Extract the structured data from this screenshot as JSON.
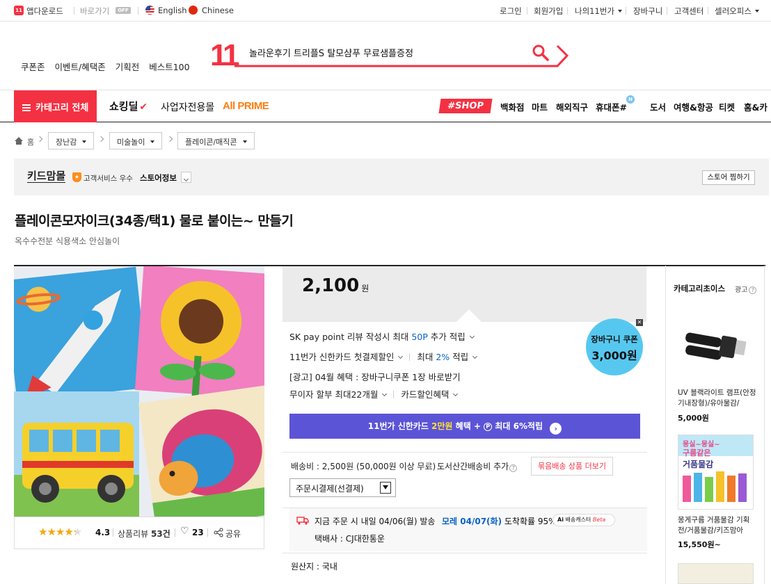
{
  "topbar": {
    "app_download": "앱다운로드",
    "shortcut": "바로가기",
    "shortcut_state": "OFF",
    "lang_en": "English",
    "lang_cn": "Chinese",
    "links": [
      "로그인",
      "회원가입",
      "나의11번가",
      "장바구니",
      "고객센터",
      "셀러오피스"
    ]
  },
  "header": {
    "logo": "11",
    "search_value": "놀라운후기 트리플S 탈모샴푸 무료샘플증정",
    "menu": [
      "쿠폰존",
      "이벤트/혜택존",
      "기획전",
      "베스트100"
    ]
  },
  "gnb": {
    "all_category": "카테고리 전체",
    "shocking_deal": "쇼킹딜",
    "business": "사업자전용몰",
    "allprime": "All PRIME",
    "shop_tag": "#SHOP",
    "right": [
      "백화점",
      "마트",
      "해외직구",
      "휴대폰#",
      "도서",
      "여행&항공",
      "티켓",
      "홈&카"
    ],
    "new_badge": "N"
  },
  "breadcrumb": {
    "home": "홈",
    "items": [
      "장난감",
      "미술놀이",
      "플레이콘/매직콘"
    ]
  },
  "store": {
    "name": "키드맘몰",
    "badge": "고객서비스 우수",
    "info": "스토어정보",
    "favorite": "스토어 찜하기"
  },
  "product": {
    "title": "플레이콘모자이크(34종/택1) 물로 붙이는~ 만들기",
    "subtitle": "옥수수전분 식용색소 안심놀이",
    "rating": "4.3",
    "review_label": "상품리뷰",
    "review_count": "53건",
    "likes": "23",
    "share": "공유",
    "stars": 4.3
  },
  "price": {
    "amount": "2,100",
    "unit": "원"
  },
  "coupon": {
    "line1": "장바구니 쿠폰",
    "line2": "3,000원"
  },
  "benefits": {
    "sk_a": "SK pay point 리뷰 작성시 최대 ",
    "sk_pt": "50P",
    "sk_b": " 추가 적립",
    "card_a": "11번가 신한카드 첫결제할인",
    "card_b": "최대 ",
    "card_pct": "2%",
    "card_c": " 적립",
    "ad": "[광고] 04월 혜택 : 장바구니쿠폰 1장 바로받기",
    "installment": "무이자 할부 최대22개월",
    "card_discount": "카드할인혜택"
  },
  "banner": {
    "a": "11번가 신한카드 ",
    "amount": "2만원",
    "b": " 혜택 + ",
    "p": "P",
    "c": " 최대 6%적립"
  },
  "shipping": {
    "fee": "배송비 : 2,500원 (50,000원 이상 무료)",
    "mountain": "도서산간배송비 추가",
    "bundle": "묶음배송 상품 더보기",
    "pay_select": "주문시결제(선결제)",
    "dispatch": "지금 주문 시 내일 04/06(월) 발송",
    "arrival": "모레 04/07(화)",
    "arrival_b": " 도착확률 95%",
    "ai_a": "Ai",
    "ai_b": "배송캐스터",
    "ai_c": "Beta",
    "courier": "택배사 : CJ대한통운",
    "origin": "원산지 : 국내"
  },
  "sidebar": {
    "title": "카테고리초이스",
    "ad": "광고",
    "items": [
      {
        "name": "UV 블랙라이트 램프(안정기내장형)/유아물감/",
        "price": "5,000원"
      },
      {
        "name": "몽게구름 거품물감 기획전/거품물감/키즈맘아",
        "price": "15,550원~"
      }
    ],
    "ad_img_text": [
      "몽실~몽실~",
      "구름같은",
      "거품물감"
    ]
  },
  "colors": {
    "brand_red": "#f43142",
    "blue": "#0a63c9",
    "banner": "#5c54d6",
    "coupon_bg": "#56c8f0"
  }
}
